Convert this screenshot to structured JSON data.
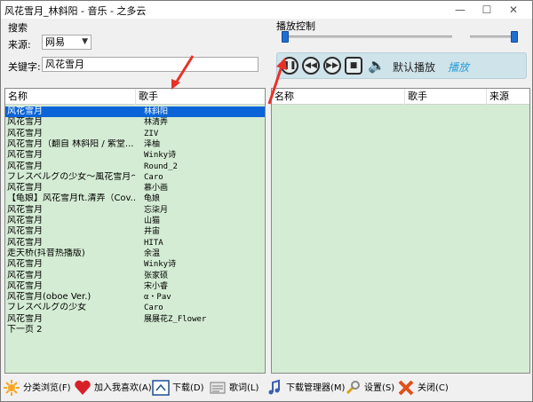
{
  "window": {
    "title": "风花雪月_林斜阳 - 音乐 - 之多云",
    "min_glyph": "—",
    "max_glyph": "☐",
    "close_glyph": "✕"
  },
  "search": {
    "group_label": "搜索",
    "source_label": "来源:",
    "source_value": "网易",
    "keyword_label": "关键字:",
    "keyword_value": "风花雪月"
  },
  "playback": {
    "group_label": "播放控制",
    "default_play_label": "默认播放",
    "play_label": "播放",
    "progress": 0.0,
    "volume": 1.0
  },
  "results": {
    "columns": [
      "名称",
      "歌手"
    ],
    "rows": [
      {
        "name": "风花雪月",
        "artist": "林斜阳",
        "selected": true
      },
      {
        "name": "风花雪月",
        "artist": "林清弄"
      },
      {
        "name": "风花雪月",
        "artist": "ZIV"
      },
      {
        "name": "风花雪月（翻自 林斜阳 / 紫堂...",
        "artist": "泽柚"
      },
      {
        "name": "风花雪月",
        "artist": "Winky诗"
      },
      {
        "name": "风花雪月",
        "artist": "Round_2"
      },
      {
        "name": "フレスベルグの少女〜風花雪月〜",
        "artist": "Caro"
      },
      {
        "name": "风花雪月",
        "artist": "慕小画"
      },
      {
        "name": "【龟娘】风花雪月ft.清弄（Cov...",
        "artist": "龟娘"
      },
      {
        "name": "风花雪月",
        "artist": "忘柒月"
      },
      {
        "name": "风花雪月",
        "artist": "山猫"
      },
      {
        "name": "风花雪月",
        "artist": "井宙"
      },
      {
        "name": "风花雪月",
        "artist": "HITA"
      },
      {
        "name": "走天桥(抖音热播版)",
        "artist": "余温"
      },
      {
        "name": "风花雪月",
        "artist": "Winky诗"
      },
      {
        "name": "风花雪月",
        "artist": "张家硕"
      },
      {
        "name": "风花雪月",
        "artist": "宋小睿"
      },
      {
        "name": "风花雪月(oboe Ver.)",
        "artist": "α・Pav"
      },
      {
        "name": "フレスベルグの少女",
        "artist": "Caro"
      },
      {
        "name": "风花雪月",
        "artist": "展展花Z_Flower"
      },
      {
        "name": "下一页 2",
        "artist": ""
      }
    ]
  },
  "playlist": {
    "columns": [
      "名称",
      "歌手",
      "来源"
    ],
    "rows": []
  },
  "toolbar": {
    "browse": "分类浏览(F)",
    "favorite": "加入我喜欢(A)",
    "download": "下载(D)",
    "lyrics": "歌词(L)",
    "download_manager": "下载管理器(M)",
    "settings": "设置(S)",
    "close": "关闭(C)"
  },
  "colors": {
    "list_bg": "#d4ecd4",
    "selection": "#0a64d8",
    "accent_blue": "#1e6fd0",
    "annotation_red": "#e5332a"
  }
}
